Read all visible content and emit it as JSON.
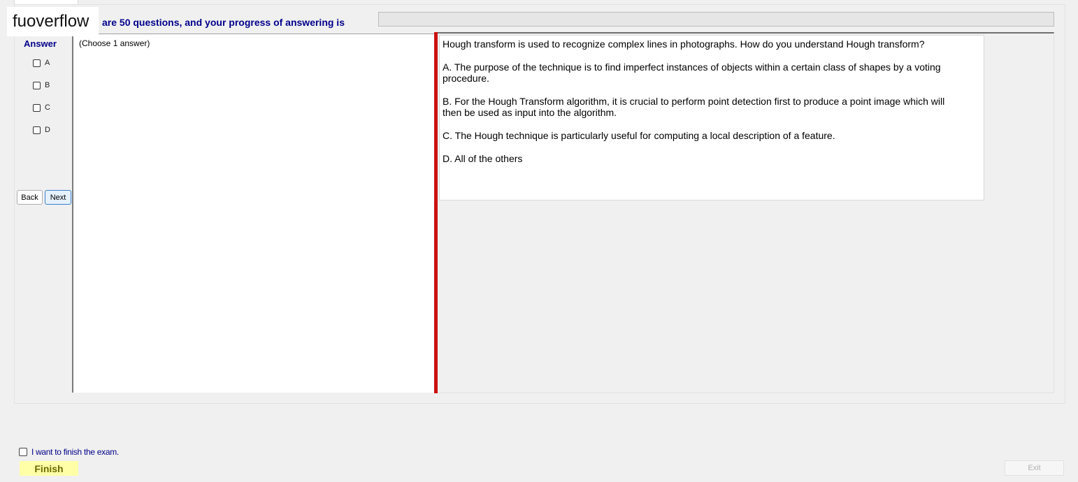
{
  "watermark": "fuoverflow",
  "header": {
    "progress_text": "are 50 questions, and your progress of answering is",
    "progress_fraction": 0
  },
  "answer": {
    "title": "Answer",
    "choose_hint": "(Choose 1 answer)",
    "options": [
      {
        "label": "A",
        "checked": false
      },
      {
        "label": "B",
        "checked": false
      },
      {
        "label": "C",
        "checked": false
      },
      {
        "label": "D",
        "checked": false
      }
    ]
  },
  "nav": {
    "back_label": "Back",
    "next_label": "Next"
  },
  "question": {
    "stem": "Hough transform is used to recognize complex lines in photographs. How do you understand Hough transform?",
    "choices": [
      "A.  The purpose of the technique is to find imperfect instances of objects within a certain class of shapes by a voting procedure.",
      "B.  For the Hough Transform algorithm, it is crucial to perform point detection first to produce a point image which will then be used as input into the algorithm.",
      "C.  The Hough technique is particularly useful for computing a local description of a feature.",
      "D.  All of the others"
    ]
  },
  "footer": {
    "finish_checkbox_label": "I want to finish the exam.",
    "finish_label": "Finish",
    "exit_label": "Exit"
  },
  "colors": {
    "accent_text": "#00008b",
    "splitter": "#cc1111",
    "finish_bg": "#ffffa8"
  }
}
